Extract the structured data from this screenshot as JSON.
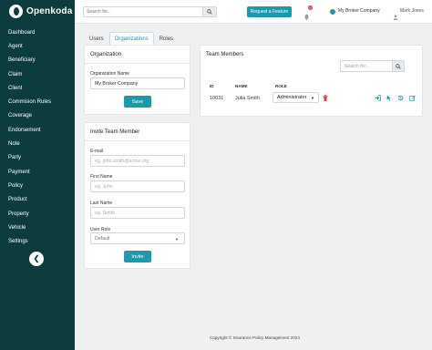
{
  "brand": {
    "name": "Openkoda"
  },
  "sidebar": {
    "items": [
      {
        "label": "Dashboard"
      },
      {
        "label": "Agent"
      },
      {
        "label": "Beneficiary"
      },
      {
        "label": "Claim"
      },
      {
        "label": "Client"
      },
      {
        "label": "Commision Rules"
      },
      {
        "label": "Coverage"
      },
      {
        "label": "Endorsement"
      },
      {
        "label": "Note"
      },
      {
        "label": "Party"
      },
      {
        "label": "Payment"
      },
      {
        "label": "Policy"
      },
      {
        "label": "Product"
      },
      {
        "label": "Property"
      },
      {
        "label": "Vehicle"
      },
      {
        "label": "Settings"
      }
    ],
    "collapse_icon": "chevron-left-icon"
  },
  "topbar": {
    "search_placeholder": "Search for...",
    "request_button": "Request a Feature",
    "notification_count": "0",
    "organization": "My Broker Company",
    "user": "Mark Jones"
  },
  "tabs": [
    {
      "label": "Users",
      "active": false
    },
    {
      "label": "Organizations",
      "active": true
    },
    {
      "label": "Roles",
      "active": false
    }
  ],
  "organization_card": {
    "title": "Organization",
    "name_label": "Organization Name",
    "name_value": "My Broker Company",
    "save_label": "Save"
  },
  "invite_card": {
    "title": "Invite Team Member",
    "email_label": "E-mail",
    "email_placeholder": "eg. john.smith@acme.org",
    "first_name_label": "First Name",
    "first_name_placeholder": "eg. John",
    "last_name_label": "Last Name",
    "last_name_placeholder": "eg. Smith",
    "role_label": "User Role",
    "role_value": "Default",
    "invite_label": "Invite"
  },
  "team_card": {
    "title": "Team Members",
    "search_placeholder": "Search for...",
    "columns": [
      "ID",
      "NAME",
      "ROLE"
    ],
    "rows": [
      {
        "id": "10031",
        "name": "Julia Smith",
        "role": "Administrator"
      }
    ]
  },
  "footer": {
    "text": "Copyright © Insurance Policy Management 2024"
  },
  "colors": {
    "sidebar": "#0c3c3e",
    "accent": "#1b9aa9",
    "danger": "#e23b4e"
  }
}
